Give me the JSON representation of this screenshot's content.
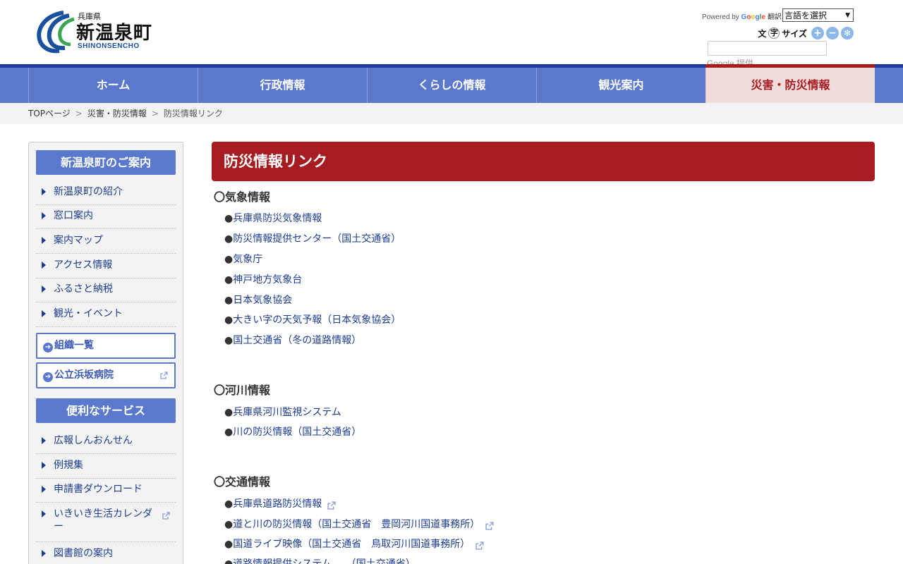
{
  "header": {
    "pref": "兵庫県",
    "town": "新温泉町",
    "roman": "SHINONSENCHO",
    "powered_by": "Powered by",
    "google": "Google",
    "translate": "翻訳",
    "language_select": "言語を選択",
    "font_size_prefix": "文",
    "font_size_ji": "字",
    "font_size_suffix": "サイズ",
    "google_provided": "Google 提供"
  },
  "nav": {
    "items": [
      {
        "label": "ホーム"
      },
      {
        "label": "行政情報"
      },
      {
        "label": "くらしの情報"
      },
      {
        "label": "観光案内"
      },
      {
        "label": "災害・防災情報"
      }
    ]
  },
  "breadcrumb": {
    "top": "TOPページ",
    "sep": ">",
    "parent": "災害・防災情報",
    "current": "防災情報リンク"
  },
  "sidebar": {
    "head1": "新温泉町のご案内",
    "items1": [
      {
        "label": "新温泉町の紹介"
      },
      {
        "label": "窓口案内"
      },
      {
        "label": "案内マップ"
      },
      {
        "label": "アクセス情報"
      },
      {
        "label": "ふるさと納税"
      },
      {
        "label": "観光・イベント"
      }
    ],
    "btn_org": "組織一覧",
    "btn_hospital": "公立浜坂病院",
    "head2": "便利なサービス",
    "items2": [
      {
        "label": "広報しんおんせん"
      },
      {
        "label": "例規集"
      },
      {
        "label": "申請書ダウンロード"
      },
      {
        "label": "いきいき生活カレンダー"
      },
      {
        "label": "図書館の案内"
      }
    ]
  },
  "main": {
    "title": "防災情報リンク",
    "sections": [
      {
        "heading": "〇気象情報",
        "links": [
          {
            "label": "兵庫県防災気象情報"
          },
          {
            "label": "防災情報提供センター（国土交通省）"
          },
          {
            "label": "気象庁"
          },
          {
            "label": "神戸地方気象台"
          },
          {
            "label": "日本気象協会"
          },
          {
            "label": "大きい字の天気予報（日本気象協会）"
          },
          {
            "label": "国土交通省（冬の道路情報）"
          }
        ]
      },
      {
        "heading": "〇河川情報",
        "links": [
          {
            "label": "兵庫県河川監視システム"
          },
          {
            "label": "川の防災情報（国土交通省）"
          }
        ]
      },
      {
        "heading": "〇交通情報",
        "links": [
          {
            "label": "兵庫県道路防災情報"
          },
          {
            "label": "道と川の防災情報（国土交通省　豊岡河川国道事務所）"
          },
          {
            "label": "国道ライブ映像（国土交通省　鳥取河川国道事務所）"
          },
          {
            "label": "道路情報提供システム　　（国土交通省）"
          }
        ]
      }
    ],
    "bullet": "●"
  },
  "colors": {
    "nav": "#5a78cc",
    "nav_top": "#1c3b9c",
    "accent_red": "#a71c20",
    "active_tab_bg": "#f1dcdc",
    "link": "#1b3c8f"
  }
}
